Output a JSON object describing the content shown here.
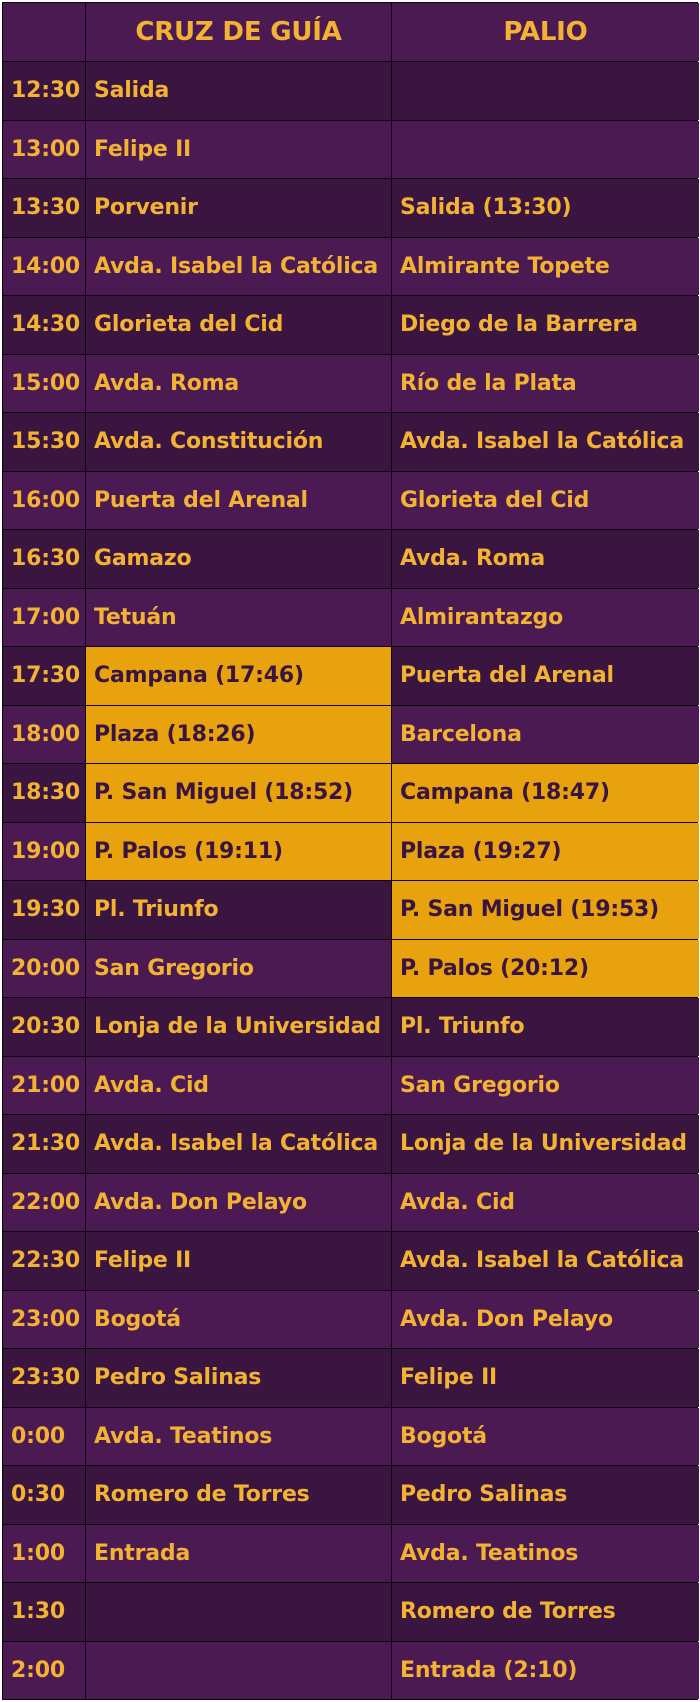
{
  "header": {
    "time_col": "",
    "cruz": "CRUZ DE GUÍA",
    "palio": "PALIO"
  },
  "colors": {
    "dark_row": "#3a1540",
    "light_row": "#4c1a52",
    "text": "#f2b233",
    "highlight": "#e8a20e",
    "highlight_text": "#3a1440"
  },
  "rows": [
    {
      "time": "12:30",
      "cruz": "Salida",
      "palio": "",
      "cruz_hl": false,
      "palio_hl": false
    },
    {
      "time": "13:00",
      "cruz": "Felipe II",
      "palio": "",
      "cruz_hl": false,
      "palio_hl": false
    },
    {
      "time": "13:30",
      "cruz": "Porvenir",
      "palio": "Salida (13:30)",
      "cruz_hl": false,
      "palio_hl": false
    },
    {
      "time": "14:00",
      "cruz": "Avda. Isabel la Católica",
      "palio": "Almirante Topete",
      "cruz_hl": false,
      "palio_hl": false
    },
    {
      "time": "14:30",
      "cruz": "Glorieta del Cid",
      "palio": "Diego de la Barrera",
      "cruz_hl": false,
      "palio_hl": false
    },
    {
      "time": "15:00",
      "cruz": "Avda. Roma",
      "palio": "Río de la Plata",
      "cruz_hl": false,
      "palio_hl": false
    },
    {
      "time": "15:30",
      "cruz": "Avda. Constitución",
      "palio": "Avda. Isabel la Católica",
      "cruz_hl": false,
      "palio_hl": false
    },
    {
      "time": "16:00",
      "cruz": "Puerta del Arenal",
      "palio": "Glorieta del Cid",
      "cruz_hl": false,
      "palio_hl": false
    },
    {
      "time": "16:30",
      "cruz": "Gamazo",
      "palio": "Avda. Roma",
      "cruz_hl": false,
      "palio_hl": false
    },
    {
      "time": "17:00",
      "cruz": "Tetuán",
      "palio": "Almirantazgo",
      "cruz_hl": false,
      "palio_hl": false
    },
    {
      "time": "17:30",
      "cruz": "Campana (17:46)",
      "palio": "Puerta del Arenal",
      "cruz_hl": true,
      "palio_hl": false
    },
    {
      "time": "18:00",
      "cruz": "Plaza (18:26)",
      "palio": "Barcelona",
      "cruz_hl": true,
      "palio_hl": false
    },
    {
      "time": "18:30",
      "cruz": "P. San Miguel (18:52)",
      "palio": "Campana (18:47)",
      "cruz_hl": true,
      "palio_hl": true
    },
    {
      "time": "19:00",
      "cruz": "P. Palos (19:11)",
      "palio": "Plaza (19:27)",
      "cruz_hl": true,
      "palio_hl": true
    },
    {
      "time": "19:30",
      "cruz": "Pl. Triunfo",
      "palio": "P. San Miguel (19:53)",
      "cruz_hl": false,
      "palio_hl": true
    },
    {
      "time": "20:00",
      "cruz": "San Gregorio",
      "palio": "P. Palos (20:12)",
      "cruz_hl": false,
      "palio_hl": true
    },
    {
      "time": "20:30",
      "cruz": "Lonja de la Universidad",
      "palio": "Pl. Triunfo",
      "cruz_hl": false,
      "palio_hl": false
    },
    {
      "time": "21:00",
      "cruz": "Avda. Cid",
      "palio": "San Gregorio",
      "cruz_hl": false,
      "palio_hl": false
    },
    {
      "time": "21:30",
      "cruz": "Avda. Isabel la Católica",
      "palio": "Lonja de la Universidad",
      "cruz_hl": false,
      "palio_hl": false
    },
    {
      "time": "22:00",
      "cruz": "Avda. Don Pelayo",
      "palio": "Avda. Cid",
      "cruz_hl": false,
      "palio_hl": false
    },
    {
      "time": "22:30",
      "cruz": "Felipe II",
      "palio": "Avda. Isabel la Católica",
      "cruz_hl": false,
      "palio_hl": false
    },
    {
      "time": "23:00",
      "cruz": "Bogotá",
      "palio": "Avda. Don Pelayo",
      "cruz_hl": false,
      "palio_hl": false
    },
    {
      "time": "23:30",
      "cruz": "Pedro Salinas",
      "palio": "Felipe II",
      "cruz_hl": false,
      "palio_hl": false
    },
    {
      "time": "0:00",
      "cruz": "Avda. Teatinos",
      "palio": "Bogotá",
      "cruz_hl": false,
      "palio_hl": false
    },
    {
      "time": "0:30",
      "cruz": "Romero de Torres",
      "palio": "Pedro Salinas",
      "cruz_hl": false,
      "palio_hl": false
    },
    {
      "time": "1:00",
      "cruz": "Entrada",
      "palio": "Avda. Teatinos",
      "cruz_hl": false,
      "palio_hl": false
    },
    {
      "time": "1:30",
      "cruz": "",
      "palio": "Romero de Torres",
      "cruz_hl": false,
      "palio_hl": false
    },
    {
      "time": "2:00",
      "cruz": "",
      "palio": "Entrada (2:10)",
      "cruz_hl": false,
      "palio_hl": false
    }
  ]
}
